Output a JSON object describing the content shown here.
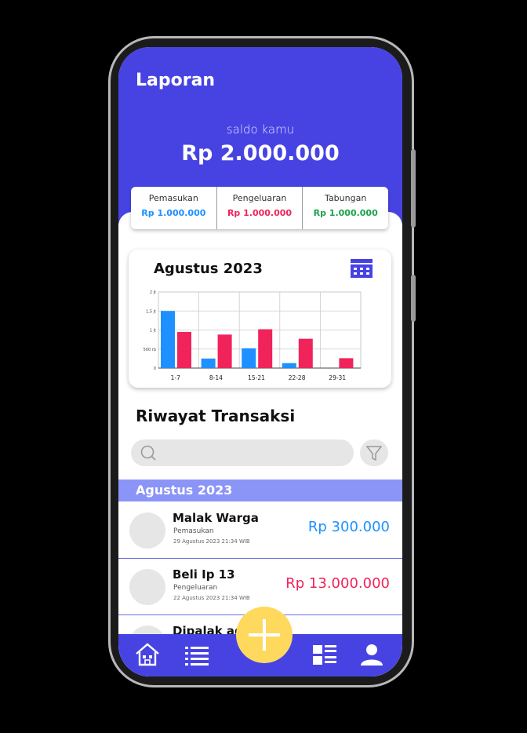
{
  "header": {
    "title": "Laporan",
    "saldo_label": "saldo kamu",
    "saldo_value": "Rp 2.000.000"
  },
  "summary": [
    {
      "label": "Pemasukan",
      "value": "Rp 1.000.000",
      "color": "#1e90ff"
    },
    {
      "label": "Pengeluaran",
      "value": "Rp 1.000.000",
      "color": "#f0245a"
    },
    {
      "label": "Tabungan",
      "value": "Rp 1.000.000",
      "color": "#1aa34a"
    }
  ],
  "report_card": {
    "month": "Agustus 2023",
    "icon": "calendar-icon"
  },
  "chart_data": {
    "type": "bar",
    "categories": [
      "1-7",
      "8-14",
      "15-21",
      "22-28",
      "29-31"
    ],
    "ytick_labels": [
      "0",
      "500 rb",
      "1 jt",
      "1,5 jt",
      "2 jt"
    ],
    "ylim": [
      0,
      2000000
    ],
    "grid": true,
    "series": [
      {
        "values": [
          1500000,
          250000,
          520000,
          130000,
          0
        ],
        "color": "#1e90ff"
      },
      {
        "values": [
          950000,
          880000,
          1020000,
          770000,
          260000
        ],
        "color": "#f0245a"
      }
    ]
  },
  "history": {
    "title": "Riwayat Transaksi",
    "search_placeholder": "",
    "month_header": "Agustus 2023",
    "transactions": [
      {
        "name": "Malak Warga",
        "type": "Pemasukan",
        "date": "29 Agustus 2023 21:34 WIB",
        "amount": "Rp 300.000",
        "color": "#1e90ff"
      },
      {
        "name": "Beli Ip 13",
        "type": "Pengeluaran",
        "date": "22 Agustus 2023 21:34 WIB",
        "amount": "Rp 13.000.000",
        "color": "#f0245a"
      },
      {
        "name": "Dipalak ag",
        "type": "",
        "date": "",
        "amount": "",
        "color": "#111111"
      }
    ]
  },
  "nav": {
    "items": [
      "home-icon",
      "list-icon",
      "add-icon",
      "report-icon",
      "profile-icon"
    ],
    "accent": "#4743e3",
    "fab_color": "#ffd95e"
  }
}
